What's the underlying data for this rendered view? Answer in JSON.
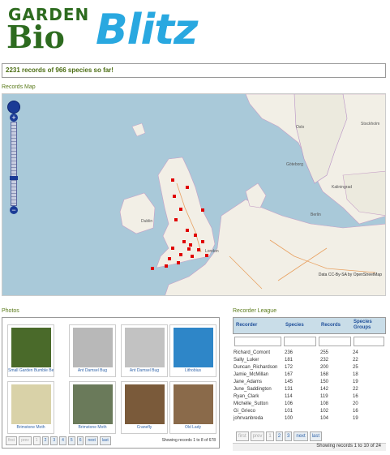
{
  "logo": {
    "garden": "GARDEN",
    "bio": "Bio",
    "blitz": "Blitz"
  },
  "status": "2231 records of 966 species so far!",
  "map": {
    "title": "Records Map",
    "attribution": "Data CC-By-SA by OpenStreetMap",
    "labels": [
      "Oslo",
      "Stockholm",
      "Göteborg",
      "Kaliningrad",
      "Dublin",
      "Berlin",
      "London"
    ]
  },
  "photos": {
    "title": "Photos",
    "items": [
      {
        "caption": "Small Garden Bumble Bee",
        "color": "#4a6a2a"
      },
      {
        "caption": "Ant Damsel Bug",
        "color": "#b8b8b8"
      },
      {
        "caption": "Ant Damsel Bug",
        "color": "#c2c2c2"
      },
      {
        "caption": "Lithobius",
        "color": "#2e86c8"
      },
      {
        "caption": "Brimstone Moth",
        "color": "#d9d2a8"
      },
      {
        "caption": "Brimstone Moth",
        "color": "#6a7a5a"
      },
      {
        "caption": "Cranefly",
        "color": "#7a5a3a"
      },
      {
        "caption": "Old Lady",
        "color": "#8a6a4a"
      }
    ],
    "pager": [
      "first",
      "prev",
      "1",
      "2",
      "3",
      "4",
      "5",
      "6",
      "next",
      "last"
    ],
    "info": "Showing records 1 to 8 of 678"
  },
  "league": {
    "title": "Recorder League",
    "headers": {
      "recorder": "Recorder",
      "species": "Species",
      "records": "Records",
      "groups": "Species Groups"
    },
    "rows": [
      [
        "Richard_Comont",
        "236",
        "255",
        "24"
      ],
      [
        "Sally_Luker",
        "181",
        "232",
        "22"
      ],
      [
        "Duncan_Richardson",
        "172",
        "200",
        "25"
      ],
      [
        "Jamie_McMillan",
        "167",
        "168",
        "18"
      ],
      [
        "Jane_Adams",
        "145",
        "150",
        "19"
      ],
      [
        "June_Saddington",
        "131",
        "142",
        "22"
      ],
      [
        "Ryan_Clark",
        "114",
        "119",
        "16"
      ],
      [
        "Michelle_Sutton",
        "106",
        "108",
        "20"
      ],
      [
        "Gi_Grieco",
        "101",
        "102",
        "16"
      ],
      [
        "johnvanbreda",
        "100",
        "104",
        "19"
      ]
    ],
    "pager": [
      "first",
      "prev",
      "1",
      "2",
      "3",
      "next",
      "last"
    ],
    "info": "Showing records 1 to 10 of 24"
  }
}
